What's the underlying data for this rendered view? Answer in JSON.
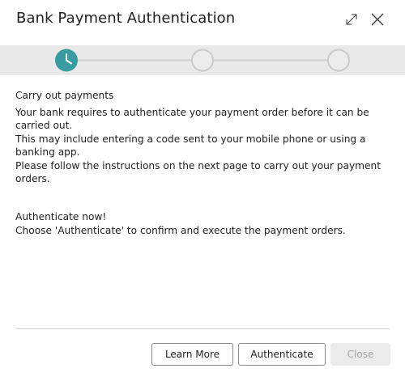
{
  "dialog": {
    "title": "Bank Payment Authentication"
  },
  "header_icons": {
    "expand": "expand-icon",
    "close": "close-icon"
  },
  "stepper": {
    "total_steps": 3,
    "current_step": 1,
    "current_step_icon": "clock-icon",
    "accent_color": "#3a9ca3"
  },
  "content": {
    "section1": {
      "heading": "Carry out payments",
      "lines": [
        "Your bank requires to authenticate your payment order before it can be carried out.",
        "This may include entering a code sent to your mobile phone or using a banking app.",
        "Please follow the instructions on the next page to carry out your payment orders."
      ]
    },
    "section2": {
      "heading": "Authenticate now!",
      "lines": [
        "Choose 'Authenticate' to confirm and execute the payment orders."
      ]
    }
  },
  "buttons": {
    "learn_more": "Learn More",
    "authenticate": "Authenticate",
    "close": "Close"
  }
}
